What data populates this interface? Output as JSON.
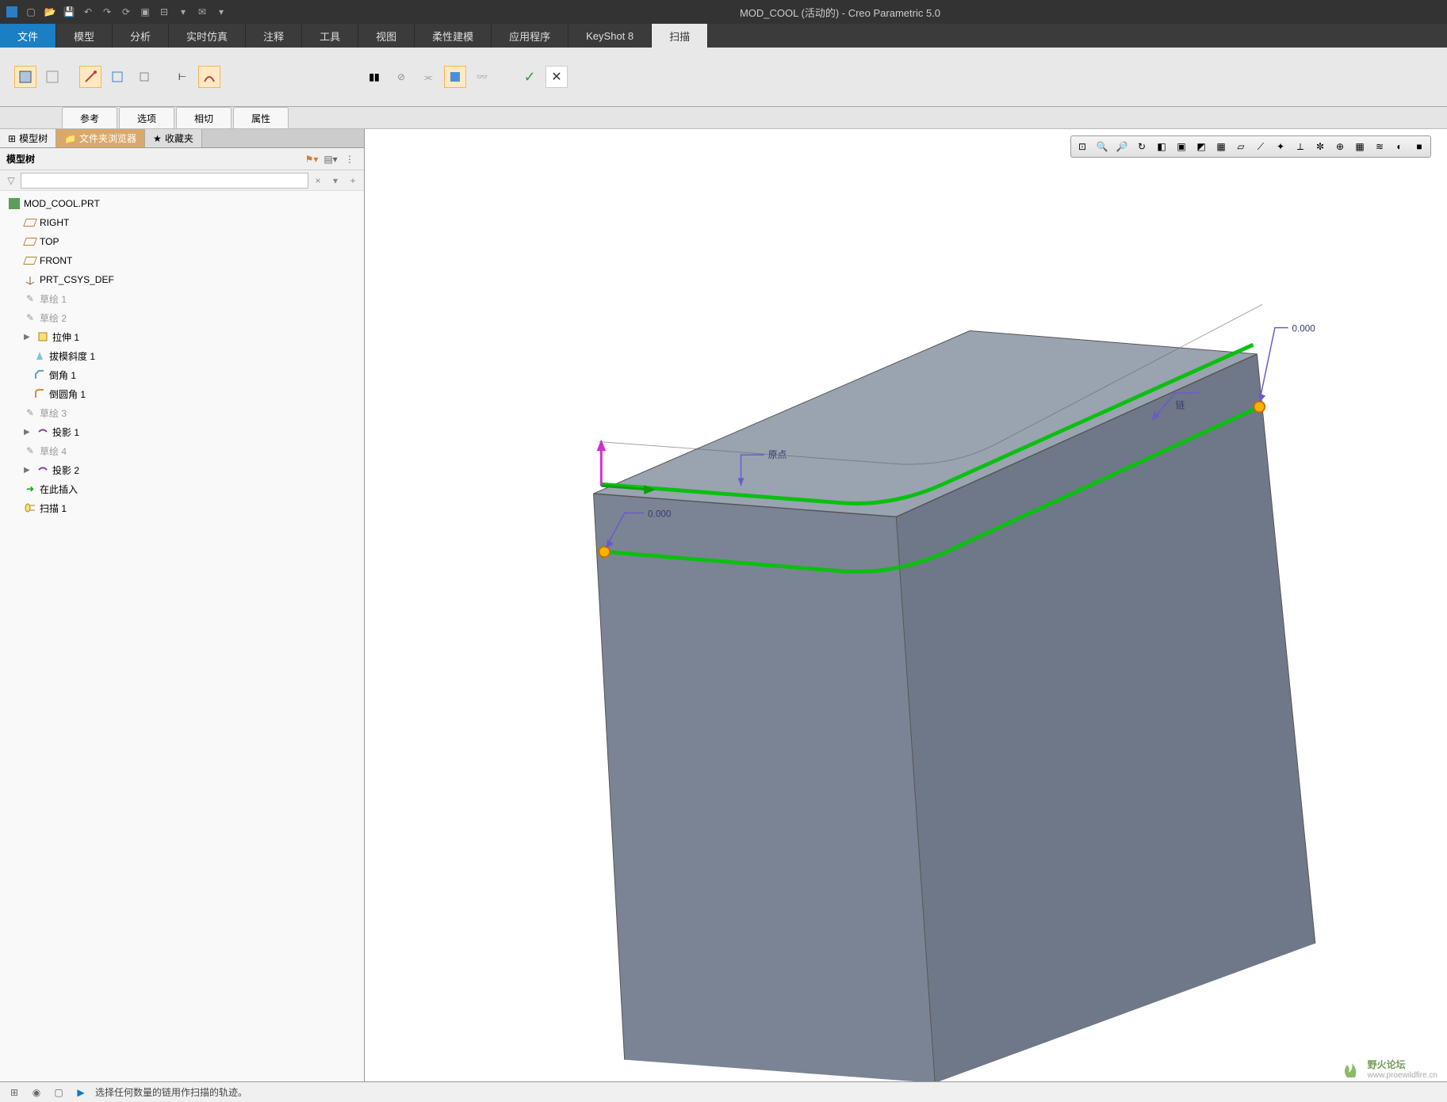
{
  "title": "MOD_COOL (活动的) - Creo Parametric 5.0",
  "menu": {
    "file": "文件",
    "model": "模型",
    "analysis": "分析",
    "sim": "实时仿真",
    "annotate": "注释",
    "tools": "工具",
    "view": "视图",
    "flex": "柔性建模",
    "app": "应用程序",
    "keyshot": "KeyShot 8",
    "sweep": "扫描"
  },
  "subtabs": {
    "ref": "参考",
    "opt": "选项",
    "tan": "相切",
    "attr": "属性"
  },
  "sidetabs": {
    "tree": "模型树",
    "folder": "文件夹浏览器",
    "fav": "收藏夹"
  },
  "treehead": "模型树",
  "filter_placeholder": "",
  "tree": {
    "root": "MOD_COOL.PRT",
    "right": "RIGHT",
    "top": "TOP",
    "front": "FRONT",
    "csys": "PRT_CSYS_DEF",
    "sk1": "草绘 1",
    "sk2": "草绘 2",
    "ext1": "拉伸 1",
    "draft": "拔模斜度 1",
    "chamf": "倒角 1",
    "round": "倒圆角 1",
    "sk3": "草绘 3",
    "proj1": "投影 1",
    "sk4": "草绘 4",
    "proj2": "投影 2",
    "insert": "在此插入",
    "sweep": "扫描 1"
  },
  "annotations": {
    "origin": "原点",
    "chain": "链",
    "dim1": "0.000",
    "dim2": "0.000"
  },
  "status": "选择任何数量的链用作扫描的轨迹。",
  "watermark": {
    "main": "野火论坛",
    "sub": "www.proewildfire.cn"
  }
}
